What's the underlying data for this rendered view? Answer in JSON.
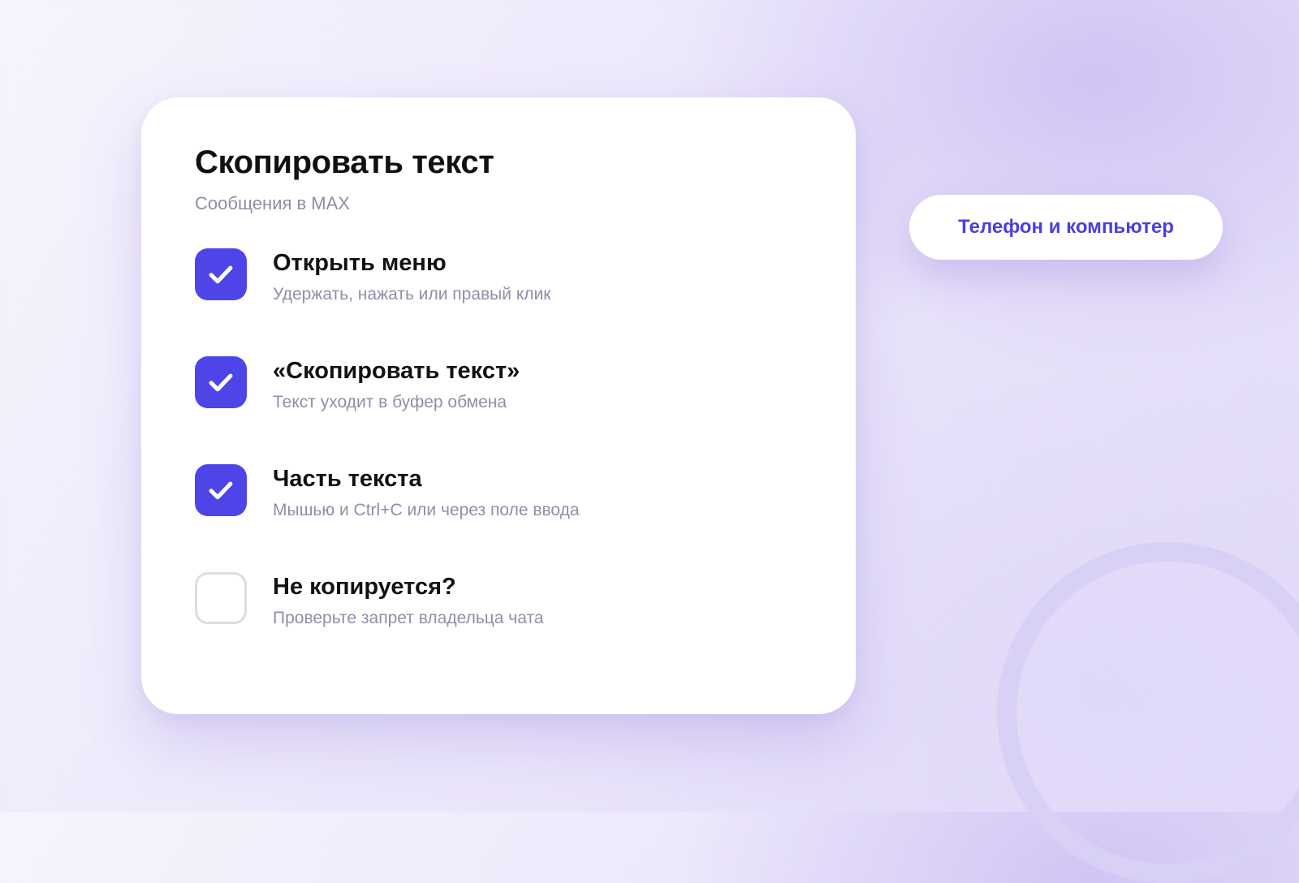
{
  "card": {
    "title": "Скопировать текст",
    "subtitle": "Сообщения в MAX",
    "steps": [
      {
        "title": "Открыть меню",
        "description": "Удержать, нажать или правый клик",
        "checked": true
      },
      {
        "title": "«Скопировать текст»",
        "description": "Текст уходит в буфер обмена",
        "checked": true
      },
      {
        "title": "Часть текста",
        "description": "Мышью и Ctrl+C или через поле ввода",
        "checked": true
      },
      {
        "title": "Не копируется?",
        "description": "Проверьте запрет владельца чата",
        "checked": false
      }
    ]
  },
  "platform_pill": {
    "label": "Телефон и компьютер"
  },
  "icons": {
    "check": "check-icon"
  },
  "colors": {
    "accent": "#4d45e8",
    "pill_text": "#4a3fe0",
    "muted_text": "#8e8fa6",
    "unchecked_border": "#dcdce6"
  }
}
